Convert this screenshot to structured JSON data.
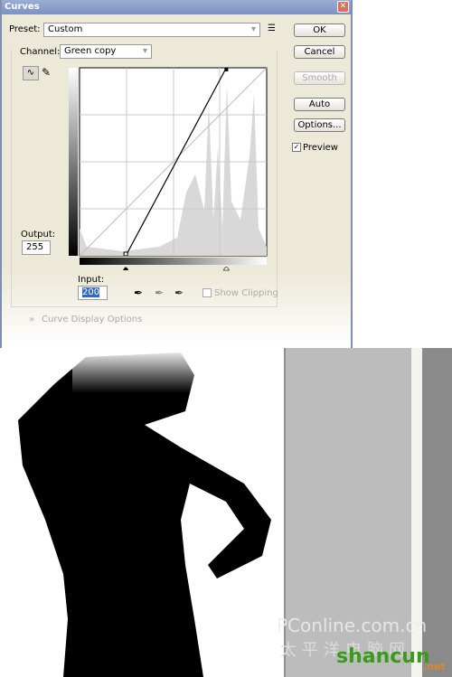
{
  "window": {
    "title": "Curves"
  },
  "preset": {
    "label": "Preset:",
    "value": "Custom"
  },
  "channel": {
    "label": "Channel:",
    "value": "Green copy"
  },
  "buttons": {
    "ok": "OK",
    "cancel": "Cancel",
    "smooth": "Smooth",
    "auto": "Auto",
    "options": "Options..."
  },
  "preview": {
    "label": "Preview",
    "checked": true
  },
  "output": {
    "label": "Output:",
    "value": "255"
  },
  "input": {
    "label": "Input:",
    "value": "200"
  },
  "show_clipping": {
    "label": "Show Clipping",
    "checked": false
  },
  "curve_display_options": "Curve Display Options",
  "curve": {
    "points": [
      [
        63,
        0
      ],
      [
        200,
        255
      ]
    ]
  },
  "watermark": {
    "pconline": "PConline.com.cn",
    "cn": "太平洋电脑网",
    "shancun": "shancun",
    "net": ".net"
  }
}
